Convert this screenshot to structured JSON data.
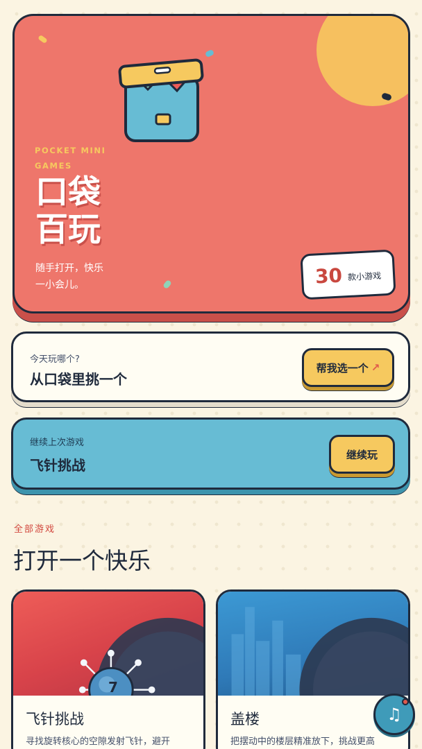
{
  "hero": {
    "eyebrow": "POCKET MINI GAMES",
    "title_line1": "口袋",
    "title_line2": "百玩",
    "desc_line1": "随手打开，快乐",
    "desc_line2": "一小会儿。",
    "count_number": "30",
    "count_label": "款小游戏"
  },
  "pick_card": {
    "sub": "今天玩哪个?",
    "main": "从口袋里挑一个",
    "button_label": "帮我选一个",
    "button_arrow": "↗"
  },
  "continue_card": {
    "sub": "继续上次游戏",
    "main": "飞针挑战",
    "button_label": "继续玩"
  },
  "section": {
    "eyebrow": "全部游戏",
    "title": "打开一个快乐"
  },
  "games": [
    {
      "name": "飞针挑战",
      "desc": "寻找旋转核心的空隙发射飞针，避开",
      "badge": "7"
    },
    {
      "name": "盖楼",
      "desc": "把摆动中的楼层精准放下，挑战更高"
    }
  ],
  "music": {
    "icon": "music-note-icon",
    "glyph": "♫"
  },
  "colors": {
    "background": "#fbf4e2",
    "hero": "#ee766b",
    "accent_yellow": "#f6c95f",
    "accent_blue": "#67bcd4",
    "ink": "#1f2a3c"
  }
}
